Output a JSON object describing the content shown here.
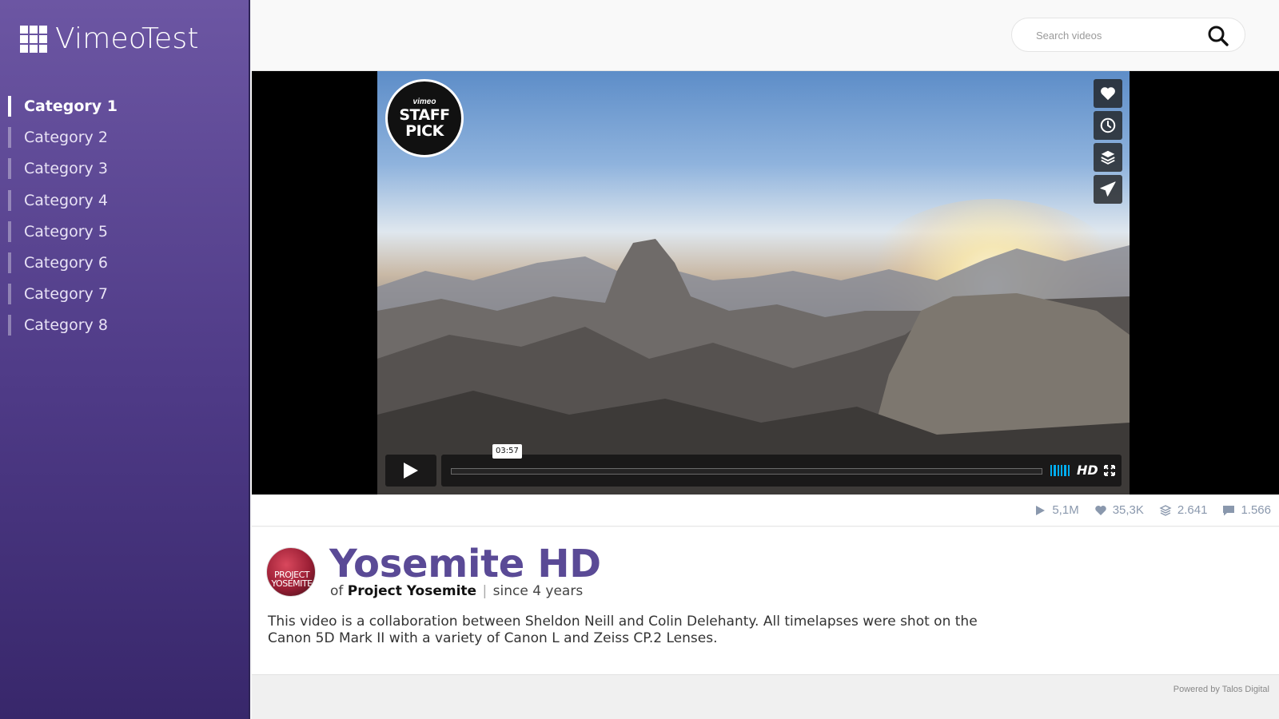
{
  "brand": {
    "title": "VimeoTest",
    "icon": "grid-icon"
  },
  "sidebar": {
    "items": [
      {
        "label": "Category 1",
        "active": true
      },
      {
        "label": "Category 2",
        "active": false
      },
      {
        "label": "Category 3",
        "active": false
      },
      {
        "label": "Category 4",
        "active": false
      },
      {
        "label": "Category 5",
        "active": false
      },
      {
        "label": "Category 6",
        "active": false
      },
      {
        "label": "Category 7",
        "active": false
      },
      {
        "label": "Category 8",
        "active": false
      }
    ]
  },
  "search": {
    "placeholder": "Search videos",
    "value": "",
    "icon": "search-icon"
  },
  "player": {
    "badge": {
      "small": "vimeo",
      "line1": "STAFF",
      "line2": "PICK"
    },
    "actions": [
      "heart-icon",
      "clock-icon",
      "stack-icon",
      "send-icon"
    ],
    "duration": "03:57",
    "progress": 0,
    "quality": "HD"
  },
  "stats": {
    "plays": "5,1M",
    "likes": "35,3K",
    "collections": "2.641",
    "comments": "1.566"
  },
  "video": {
    "title": "Yosemite HD",
    "by_prefix": "of",
    "author": "Project Yosemite",
    "separator": "|",
    "age": "since 4 years",
    "avatar_text_1": "PROJECT",
    "avatar_text_2": "YOSEMITE",
    "description": "This video is a collaboration between Sheldon Neill and Colin Delehanty. All timelapses were shot on the Canon 5D Mark II with a variety of Canon L and Zeiss CP.2 Lenses."
  },
  "footer": {
    "text": "Powered by Talos Digital"
  },
  "colors": {
    "accent": "#5a4a96",
    "sidebar_top": "#6c56a3",
    "sidebar_bottom": "#38276b",
    "player_blue": "#00adef",
    "stat_text": "#8a98ad"
  }
}
